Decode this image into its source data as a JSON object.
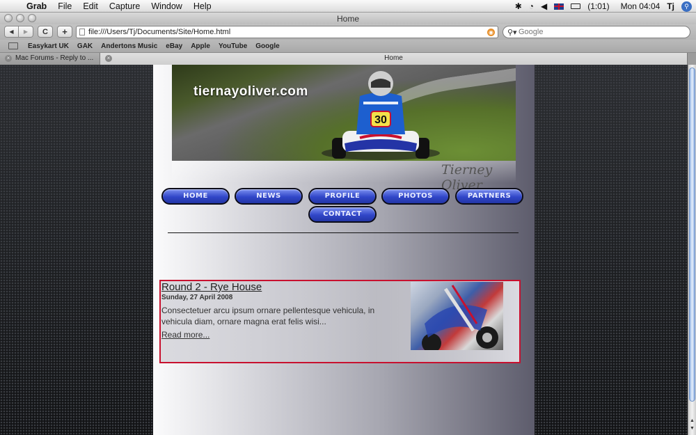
{
  "menubar": {
    "app_name": "Grab",
    "items": [
      "File",
      "Edit",
      "Capture",
      "Window",
      "Help"
    ],
    "battery": "(1:01)",
    "clock": "Mon 04:04",
    "user": "Tj"
  },
  "window": {
    "title": "Home"
  },
  "toolbar": {
    "back_icon": "◀",
    "forward_icon": "▶",
    "reload_icon": "C",
    "add_icon": "+",
    "url": "file:///Users/Tj/Documents/Site/Home.html",
    "search_placeholder": "Google"
  },
  "bookmarks": [
    "Easykart UK",
    "GAK",
    "Andertons Music",
    "eBay",
    "Apple",
    "YouTube",
    "Google"
  ],
  "tabs": [
    {
      "label": "Mac Forums - Reply to ...",
      "active": false
    },
    {
      "label": "Home",
      "active": true
    }
  ],
  "site": {
    "name": "tiernayoliver.com",
    "signature": "Tierney Oliver",
    "kart_number": "30",
    "nav": [
      "Home",
      "News",
      "Profile",
      "Photos",
      "Partners",
      "Contact"
    ]
  },
  "news": {
    "title": "Round 2 - Rye House",
    "date": "Sunday, 27 April 2008",
    "body": "Consectetuer arcu ipsum ornare pellentesque vehicula, in vehicula diam, ornare magna erat felis wisi...",
    "read_more": "Read more..."
  },
  "colors": {
    "nav_button": "#3146c8",
    "news_border": "#c8102e"
  }
}
